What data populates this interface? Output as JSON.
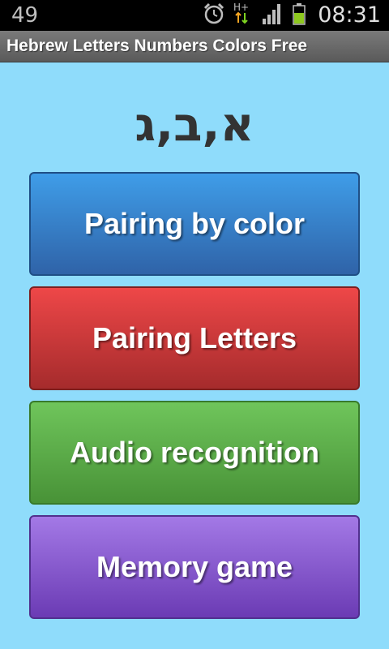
{
  "status_bar": {
    "notification_count": "49",
    "network_type": "H+",
    "time": "08:31",
    "icons": [
      "alarm-icon",
      "network-hplus-icon",
      "signal-icon",
      "battery-icon"
    ]
  },
  "app": {
    "title": "Hebrew Letters Numbers Colors Free"
  },
  "main": {
    "heading": "א,ב,ג",
    "menu": [
      {
        "label": "Pairing by color",
        "color": "#3478c8"
      },
      {
        "label": "Pairing Letters",
        "color": "#d13b3c"
      },
      {
        "label": "Audio recognition",
        "color": "#5aaa48"
      },
      {
        "label": "Memory game",
        "color": "#8a5ad0"
      }
    ]
  },
  "colors": {
    "background": "#8fdcfb",
    "status_bar": "#000000",
    "title_bar": "#6a6a6a"
  }
}
